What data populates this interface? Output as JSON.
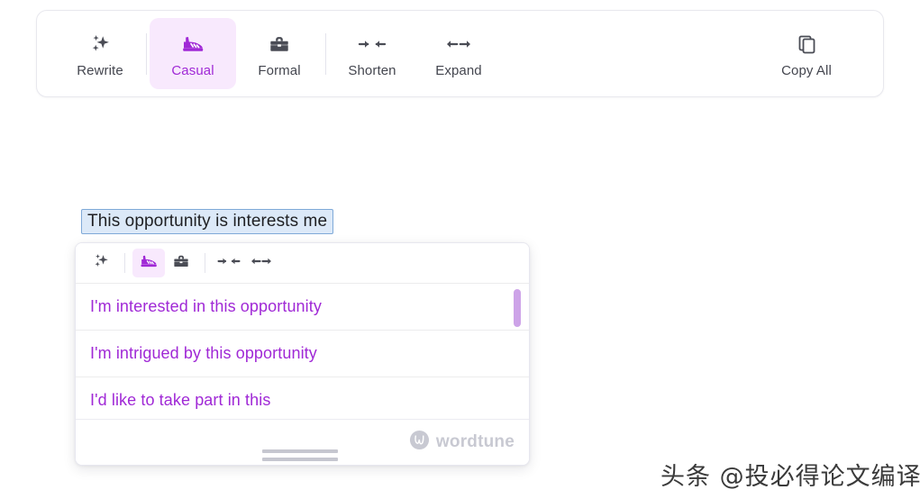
{
  "toolbar": {
    "items": [
      {
        "label": "Rewrite",
        "icon": "sparkles-icon",
        "active": false
      },
      {
        "label": "Casual",
        "icon": "shoe-icon",
        "active": true
      },
      {
        "label": "Formal",
        "icon": "briefcase-icon",
        "active": false
      },
      {
        "label": "Shorten",
        "icon": "shorten-arrows-icon",
        "active": false
      },
      {
        "label": "Expand",
        "icon": "expand-arrows-icon",
        "active": false
      }
    ],
    "copy_all": {
      "label": "Copy All",
      "icon": "copy-icon"
    }
  },
  "editor": {
    "selected_text": "This opportunity is interests me"
  },
  "popup": {
    "toolbar_icons": [
      {
        "name": "sparkles-icon",
        "active": false
      },
      {
        "name": "shoe-icon",
        "active": true
      },
      {
        "name": "briefcase-icon",
        "active": false
      },
      {
        "name": "shorten-arrows-icon",
        "active": false
      },
      {
        "name": "expand-arrows-icon",
        "active": false
      }
    ],
    "suggestions": [
      "I'm interested in this opportunity",
      "I'm intrigued by this opportunity",
      "I'd like to take part in this"
    ],
    "brand": "wordtune"
  },
  "watermark": "头条 @投必得论文编译",
  "colors": {
    "accent_purple": "#a029d6",
    "accent_purple_bg": "#f8e9fd",
    "icon_gray": "#4a4c55",
    "selection_bg": "#dce9f8",
    "selection_border": "#7fa9d8",
    "scrollbar_thumb": "#cda3e8",
    "brand_gray": "#c8c9d2"
  }
}
